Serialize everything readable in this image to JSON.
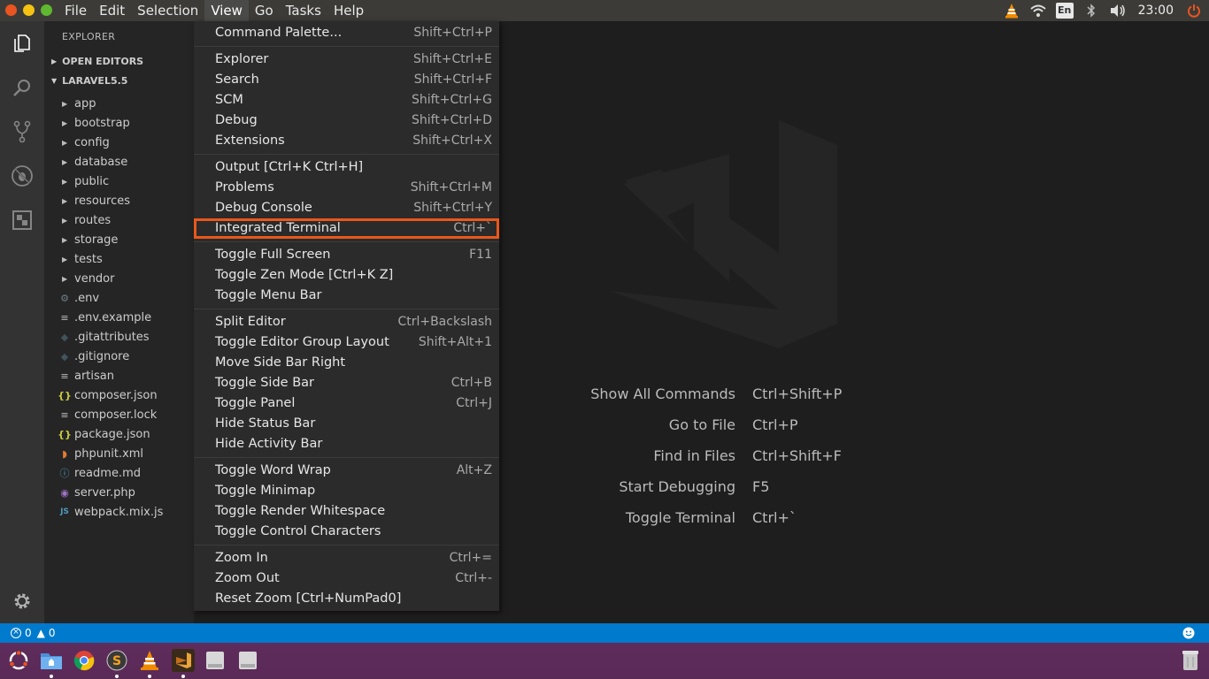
{
  "menubar": {
    "items": [
      "File",
      "Edit",
      "Selection",
      "View",
      "Go",
      "Tasks",
      "Help"
    ],
    "active": "View"
  },
  "tray": {
    "lang": "En",
    "time": "23:00"
  },
  "sidebar": {
    "title": "EXPLORER",
    "open_editors": "OPEN EDITORS",
    "project": "LARAVEL5.5",
    "folders": [
      "app",
      "bootstrap",
      "config",
      "database",
      "public",
      "resources",
      "routes",
      "storage",
      "tests",
      "vendor"
    ],
    "files": [
      {
        "name": ".env",
        "icon": "gear-icon",
        "color": "#6d8086",
        "glyph": "⚙"
      },
      {
        "name": ".env.example",
        "icon": "lines-icon",
        "color": "#bbbbbb",
        "glyph": "≡"
      },
      {
        "name": ".gitattributes",
        "icon": "git-icon",
        "color": "#41535b",
        "glyph": "◆"
      },
      {
        "name": ".gitignore",
        "icon": "git-icon",
        "color": "#41535b",
        "glyph": "◆"
      },
      {
        "name": "artisan",
        "icon": "lines-icon",
        "color": "#bbbbbb",
        "glyph": "≡"
      },
      {
        "name": "composer.json",
        "icon": "json-icon",
        "color": "#cbcb41",
        "glyph": "{}"
      },
      {
        "name": "composer.lock",
        "icon": "lines-icon",
        "color": "#bbbbbb",
        "glyph": "≡"
      },
      {
        "name": "package.json",
        "icon": "json-icon",
        "color": "#cbcb41",
        "glyph": "{}"
      },
      {
        "name": "phpunit.xml",
        "icon": "rss-icon",
        "color": "#e37933",
        "glyph": "◗"
      },
      {
        "name": "readme.md",
        "icon": "info-icon",
        "color": "#519aba",
        "glyph": "ⓘ"
      },
      {
        "name": "server.php",
        "icon": "php-icon",
        "color": "#a074c4",
        "glyph": "◉"
      },
      {
        "name": "webpack.mix.js",
        "icon": "js-icon",
        "color": "#519aba",
        "glyph": "JS"
      }
    ]
  },
  "view_menu": {
    "groups": [
      [
        {
          "label": "Command Palette...",
          "key": "Shift+Ctrl+P"
        }
      ],
      [
        {
          "label": "Explorer",
          "key": "Shift+Ctrl+E"
        },
        {
          "label": "Search",
          "key": "Shift+Ctrl+F"
        },
        {
          "label": "SCM",
          "key": "Shift+Ctrl+G"
        },
        {
          "label": "Debug",
          "key": "Shift+Ctrl+D"
        },
        {
          "label": "Extensions",
          "key": "Shift+Ctrl+X"
        }
      ],
      [
        {
          "label": "Output [Ctrl+K Ctrl+H]",
          "key": ""
        },
        {
          "label": "Problems",
          "key": "Shift+Ctrl+M"
        },
        {
          "label": "Debug Console",
          "key": "Shift+Ctrl+Y"
        },
        {
          "label": "Integrated Terminal",
          "key": "Ctrl+`",
          "highlighted": true
        }
      ],
      [
        {
          "label": "Toggle Full Screen",
          "key": "F11"
        },
        {
          "label": "Toggle Zen Mode [Ctrl+K Z]",
          "key": ""
        },
        {
          "label": "Toggle Menu Bar",
          "key": ""
        }
      ],
      [
        {
          "label": "Split Editor",
          "key": "Ctrl+Backslash"
        },
        {
          "label": "Toggle Editor Group Layout",
          "key": "Shift+Alt+1"
        },
        {
          "label": "Move Side Bar Right",
          "key": ""
        },
        {
          "label": "Toggle Side Bar",
          "key": "Ctrl+B"
        },
        {
          "label": "Toggle Panel",
          "key": "Ctrl+J"
        },
        {
          "label": "Hide Status Bar",
          "key": ""
        },
        {
          "label": "Hide Activity Bar",
          "key": ""
        }
      ],
      [
        {
          "label": "Toggle Word Wrap",
          "key": "Alt+Z"
        },
        {
          "label": "Toggle Minimap",
          "key": ""
        },
        {
          "label": "Toggle Render Whitespace",
          "key": ""
        },
        {
          "label": "Toggle Control Characters",
          "key": ""
        }
      ],
      [
        {
          "label": "Zoom In",
          "key": "Ctrl+="
        },
        {
          "label": "Zoom Out",
          "key": "Ctrl+-"
        },
        {
          "label": "Reset Zoom [Ctrl+NumPad0]",
          "key": ""
        }
      ]
    ]
  },
  "welcome": {
    "shortcuts": [
      {
        "label": "Show All Commands",
        "key": "Ctrl+Shift+P"
      },
      {
        "label": "Go to File",
        "key": "Ctrl+P"
      },
      {
        "label": "Find in Files",
        "key": "Ctrl+Shift+F"
      },
      {
        "label": "Start Debugging",
        "key": "F5"
      },
      {
        "label": "Toggle Terminal",
        "key": "Ctrl+`"
      }
    ]
  },
  "status": {
    "errors": "0",
    "warnings": "0"
  },
  "colors": {
    "accent": "#007acc",
    "highlight": "#e8581c",
    "taskbar": "#5a2a57"
  }
}
